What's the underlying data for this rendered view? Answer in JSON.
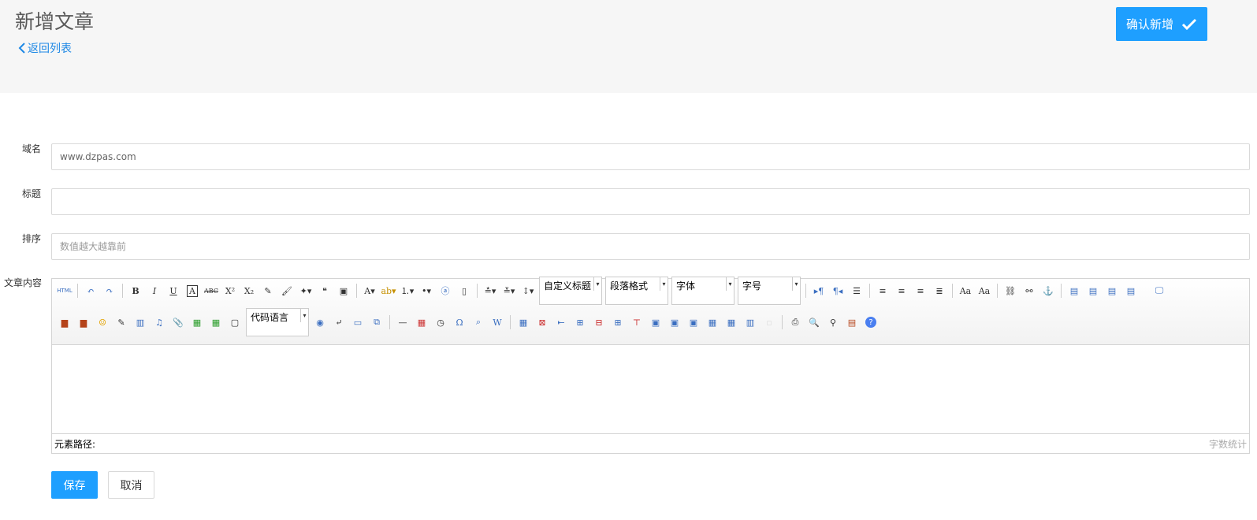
{
  "header": {
    "title": "新增文章",
    "back_label": "返回列表",
    "confirm_label": "确认新增"
  },
  "form": {
    "domain_label": "域名",
    "domain_value": "www.dzpas.com",
    "title_label": "标题",
    "title_value": "",
    "order_label": "排序",
    "order_placeholder": "数值越大越靠前",
    "content_label": "文章内容"
  },
  "editor": {
    "combos": {
      "custom_heading": "自定义标题",
      "paragraph_format": "段落格式",
      "font_family": "字体",
      "font_size": "字号",
      "code_language": "代码语言"
    },
    "status_path_label": "元素路径:",
    "word_count_label": "字数统计"
  },
  "actions": {
    "save_label": "保存",
    "cancel_label": "取消"
  },
  "colors": {
    "primary": "#1e9fff",
    "link": "#1e88e5",
    "header_bg": "#f6f6f6"
  }
}
